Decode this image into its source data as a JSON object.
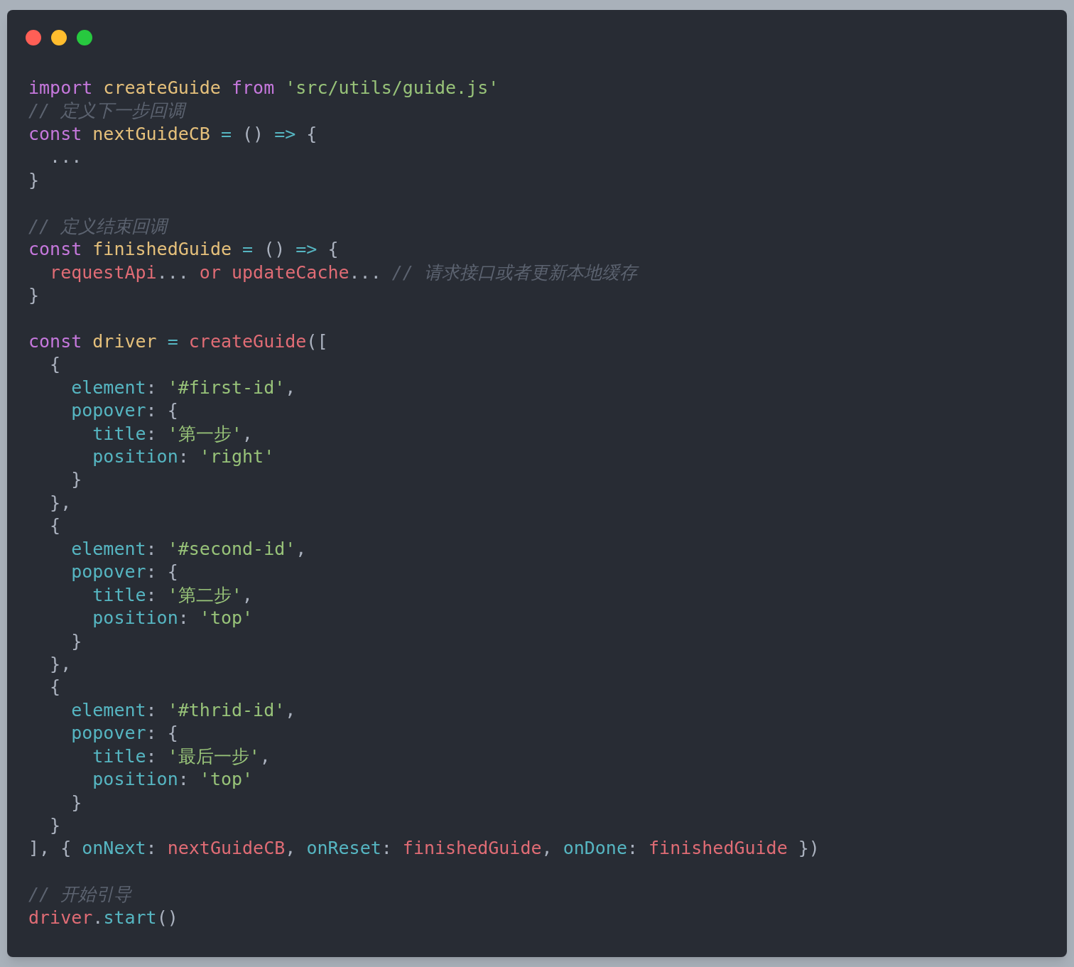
{
  "window": {
    "controls": [
      {
        "color": "#ff5f56"
      },
      {
        "color": "#ffbd2e"
      },
      {
        "color": "#27c93f"
      }
    ]
  },
  "lines": [
    {
      "kind": "code",
      "tokens": [
        {
          "kind": "keyword",
          "text": "import "
        },
        {
          "kind": "name",
          "text": "createGuide "
        },
        {
          "kind": "keyword",
          "text": "from "
        },
        {
          "kind": "string",
          "text": "'src/utils/guide.js'"
        }
      ]
    },
    {
      "kind": "code",
      "tokens": [
        {
          "kind": "comment",
          "text": "// 定义下一步回调"
        }
      ]
    },
    {
      "kind": "code",
      "tokens": [
        {
          "kind": "keyword",
          "text": "const "
        },
        {
          "kind": "name",
          "text": "nextGuideCB "
        },
        {
          "kind": "operator",
          "text": "= "
        },
        {
          "kind": "plain",
          "text": "() "
        },
        {
          "kind": "operator",
          "text": "=> "
        },
        {
          "kind": "plain",
          "text": "{"
        }
      ]
    },
    {
      "kind": "code",
      "tokens": [
        {
          "kind": "plain",
          "text": "  ..."
        }
      ]
    },
    {
      "kind": "code",
      "tokens": [
        {
          "kind": "plain",
          "text": "}"
        }
      ]
    },
    {
      "kind": "blank"
    },
    {
      "kind": "code",
      "tokens": [
        {
          "kind": "comment",
          "text": "// 定义结束回调"
        }
      ]
    },
    {
      "kind": "code",
      "tokens": [
        {
          "kind": "keyword",
          "text": "const "
        },
        {
          "kind": "name",
          "text": "finishedGuide "
        },
        {
          "kind": "operator",
          "text": "= "
        },
        {
          "kind": "plain",
          "text": "() "
        },
        {
          "kind": "operator",
          "text": "=> "
        },
        {
          "kind": "plain",
          "text": "{"
        }
      ]
    },
    {
      "kind": "code",
      "tokens": [
        {
          "kind": "call",
          "text": "  requestApi"
        },
        {
          "kind": "plain",
          "text": "... "
        },
        {
          "kind": "call",
          "text": "or updateCache"
        },
        {
          "kind": "plain",
          "text": "... "
        },
        {
          "kind": "comment",
          "text": "// 请求接口或者更新本地缓存"
        }
      ]
    },
    {
      "kind": "code",
      "tokens": [
        {
          "kind": "plain",
          "text": "}"
        }
      ]
    },
    {
      "kind": "blank"
    },
    {
      "kind": "code",
      "tokens": [
        {
          "kind": "keyword",
          "text": "const "
        },
        {
          "kind": "name",
          "text": "driver "
        },
        {
          "kind": "operator",
          "text": "= "
        },
        {
          "kind": "call",
          "text": "createGuide"
        },
        {
          "kind": "plain",
          "text": "(["
        }
      ]
    },
    {
      "kind": "code",
      "tokens": [
        {
          "kind": "plain",
          "text": "  {"
        }
      ]
    },
    {
      "kind": "code",
      "tokens": [
        {
          "kind": "property",
          "text": "    element"
        },
        {
          "kind": "plain",
          "text": ": "
        },
        {
          "kind": "string",
          "text": "'#first-id'"
        },
        {
          "kind": "plain",
          "text": ","
        }
      ]
    },
    {
      "kind": "code",
      "tokens": [
        {
          "kind": "property",
          "text": "    popover"
        },
        {
          "kind": "plain",
          "text": ": {"
        }
      ]
    },
    {
      "kind": "code",
      "tokens": [
        {
          "kind": "property",
          "text": "      title"
        },
        {
          "kind": "plain",
          "text": ": "
        },
        {
          "kind": "string",
          "text": "'第一步'"
        },
        {
          "kind": "plain",
          "text": ","
        }
      ]
    },
    {
      "kind": "code",
      "tokens": [
        {
          "kind": "property",
          "text": "      position"
        },
        {
          "kind": "plain",
          "text": ": "
        },
        {
          "kind": "string",
          "text": "'right'"
        }
      ]
    },
    {
      "kind": "code",
      "tokens": [
        {
          "kind": "plain",
          "text": "    }"
        }
      ]
    },
    {
      "kind": "code",
      "tokens": [
        {
          "kind": "plain",
          "text": "  },"
        }
      ]
    },
    {
      "kind": "code",
      "tokens": [
        {
          "kind": "plain",
          "text": "  {"
        }
      ]
    },
    {
      "kind": "code",
      "tokens": [
        {
          "kind": "property",
          "text": "    element"
        },
        {
          "kind": "plain",
          "text": ": "
        },
        {
          "kind": "string",
          "text": "'#second-id'"
        },
        {
          "kind": "plain",
          "text": ","
        }
      ]
    },
    {
      "kind": "code",
      "tokens": [
        {
          "kind": "property",
          "text": "    popover"
        },
        {
          "kind": "plain",
          "text": ": {"
        }
      ]
    },
    {
      "kind": "code",
      "tokens": [
        {
          "kind": "property",
          "text": "      title"
        },
        {
          "kind": "plain",
          "text": ": "
        },
        {
          "kind": "string",
          "text": "'第二步'"
        },
        {
          "kind": "plain",
          "text": ","
        }
      ]
    },
    {
      "kind": "code",
      "tokens": [
        {
          "kind": "property",
          "text": "      position"
        },
        {
          "kind": "plain",
          "text": ": "
        },
        {
          "kind": "string",
          "text": "'top'"
        }
      ]
    },
    {
      "kind": "code",
      "tokens": [
        {
          "kind": "plain",
          "text": "    }"
        }
      ]
    },
    {
      "kind": "code",
      "tokens": [
        {
          "kind": "plain",
          "text": "  },"
        }
      ]
    },
    {
      "kind": "code",
      "tokens": [
        {
          "kind": "plain",
          "text": "  {"
        }
      ]
    },
    {
      "kind": "code",
      "tokens": [
        {
          "kind": "property",
          "text": "    element"
        },
        {
          "kind": "plain",
          "text": ": "
        },
        {
          "kind": "string",
          "text": "'#thrid-id'"
        },
        {
          "kind": "plain",
          "text": ","
        }
      ]
    },
    {
      "kind": "code",
      "tokens": [
        {
          "kind": "property",
          "text": "    popover"
        },
        {
          "kind": "plain",
          "text": ": {"
        }
      ]
    },
    {
      "kind": "code",
      "tokens": [
        {
          "kind": "property",
          "text": "      title"
        },
        {
          "kind": "plain",
          "text": ": "
        },
        {
          "kind": "string",
          "text": "'最后一步'"
        },
        {
          "kind": "plain",
          "text": ","
        }
      ]
    },
    {
      "kind": "code",
      "tokens": [
        {
          "kind": "property",
          "text": "      position"
        },
        {
          "kind": "plain",
          "text": ": "
        },
        {
          "kind": "string",
          "text": "'top'"
        }
      ]
    },
    {
      "kind": "code",
      "tokens": [
        {
          "kind": "plain",
          "text": "    }"
        }
      ]
    },
    {
      "kind": "code",
      "tokens": [
        {
          "kind": "plain",
          "text": "  }"
        }
      ]
    },
    {
      "kind": "code",
      "tokens": [
        {
          "kind": "plain",
          "text": "], { "
        },
        {
          "kind": "property",
          "text": "onNext"
        },
        {
          "kind": "plain",
          "text": ": "
        },
        {
          "kind": "call",
          "text": "nextGuideCB"
        },
        {
          "kind": "plain",
          "text": ", "
        },
        {
          "kind": "property",
          "text": "onReset"
        },
        {
          "kind": "plain",
          "text": ": "
        },
        {
          "kind": "call",
          "text": "finishedGuide"
        },
        {
          "kind": "plain",
          "text": ", "
        },
        {
          "kind": "property",
          "text": "onDone"
        },
        {
          "kind": "plain",
          "text": ": "
        },
        {
          "kind": "call",
          "text": "finishedGuide"
        },
        {
          "kind": "plain",
          "text": " })"
        }
      ]
    },
    {
      "kind": "blank"
    },
    {
      "kind": "code",
      "tokens": [
        {
          "kind": "comment",
          "text": "// 开始引导"
        }
      ]
    },
    {
      "kind": "code",
      "tokens": [
        {
          "kind": "call",
          "text": "driver"
        },
        {
          "kind": "plain",
          "text": "."
        },
        {
          "kind": "property",
          "text": "start"
        },
        {
          "kind": "plain",
          "text": "()"
        }
      ]
    }
  ]
}
